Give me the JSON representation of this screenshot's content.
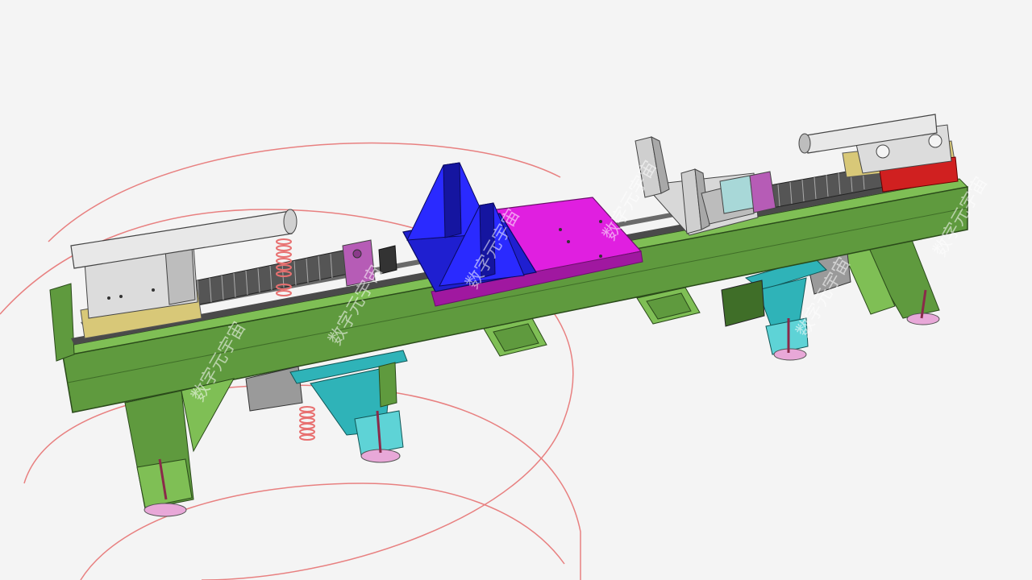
{
  "watermark": {
    "text": "数字元宇宙"
  },
  "colors": {
    "background": "#f4f4f4",
    "frame": "#5f9a3e",
    "frame_light": "#7fbf55",
    "frame_dark": "#3f6e28",
    "rail": "#4a4a4a",
    "support": "#2fb3b8",
    "fixture_blue": "#1f1fd0",
    "plate_magenta": "#e01fe0",
    "cylinder": "#e8e8e8",
    "bearing_block": "#b65cb6",
    "sketch_lines": "#e88080",
    "carriage_red": "#d02020",
    "yellow_block": "#d8c878",
    "foot_pad": "#e8a8d8",
    "spring": "#e87070"
  }
}
